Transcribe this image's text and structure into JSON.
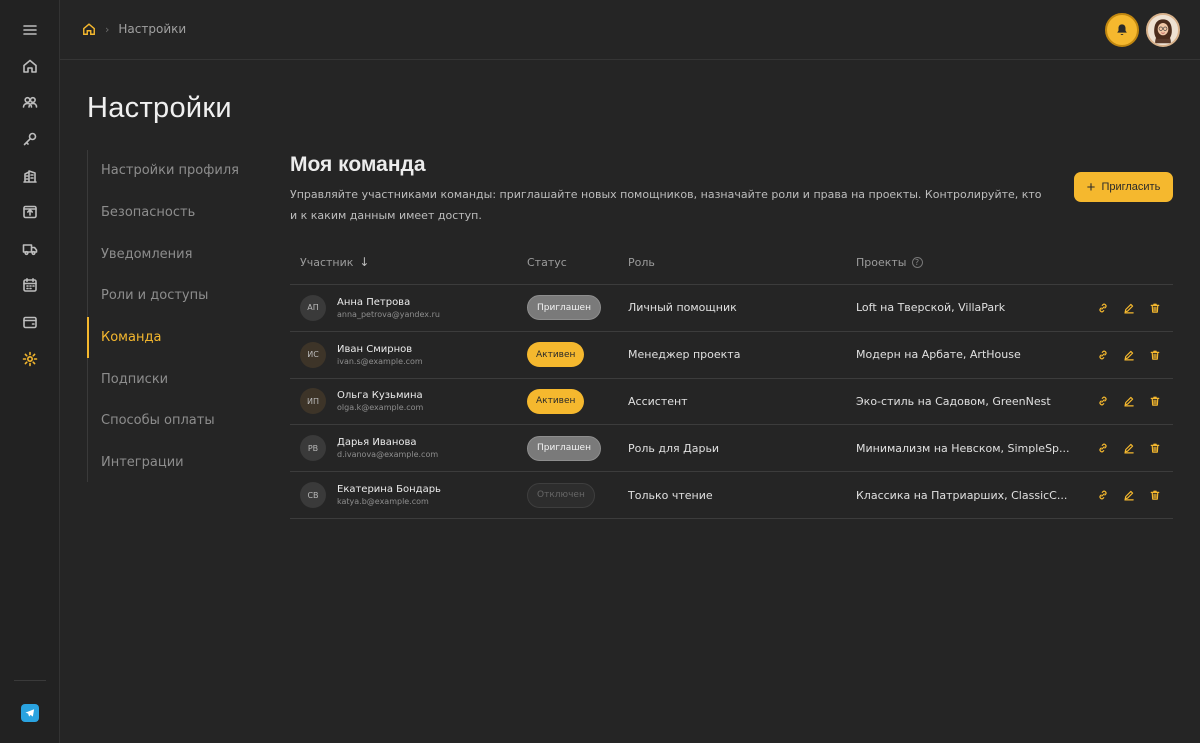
{
  "header": {
    "breadcrumb": "Настройки"
  },
  "page": {
    "title": "Настройки"
  },
  "settings_nav": [
    {
      "label": "Настройки профиля",
      "active": false
    },
    {
      "label": "Безопасность",
      "active": false
    },
    {
      "label": "Уведомления",
      "active": false
    },
    {
      "label": "Роли и доступы",
      "active": false
    },
    {
      "label": "Команда",
      "active": true
    },
    {
      "label": "Подписки",
      "active": false
    },
    {
      "label": "Способы оплаты",
      "active": false
    },
    {
      "label": "Интеграции",
      "active": false
    }
  ],
  "section": {
    "title": "Моя команда",
    "description": "Управляйте участниками команды: приглашайте новых помощников, назначайте роли и права на проекты. Контролируйте, кто и к каким данным имеет доступ.",
    "invite_label": "Пригласить"
  },
  "table": {
    "headers": {
      "member": "Участник",
      "status": "Статус",
      "role": "Роль",
      "projects": "Проекты"
    },
    "rows": [
      {
        "initials": "АП",
        "name": "Анна Петрова",
        "email": "anna_petrova@yandex.ru",
        "status": "Приглашен",
        "status_type": "invited",
        "role": "Личный помощник",
        "projects": "Loft на Тверской, VillaPark"
      },
      {
        "initials": "ИС",
        "name": "Иван Смирнов",
        "email": "ivan.s@example.com",
        "status": "Активен",
        "status_type": "active",
        "role": "Менеджер проекта",
        "projects": "Модерн на Арбате, ArtHouse"
      },
      {
        "initials": "ИП",
        "name": "Ольга Кузьмина",
        "email": "olga.k@example.com",
        "status": "Активен",
        "status_type": "active",
        "role": "Ассистент",
        "projects": "Эко-стиль на Садовом, GreenNest"
      },
      {
        "initials": "РВ",
        "name": "Дарья Иванова",
        "email": "d.ivanova@example.com",
        "status": "Приглашен",
        "status_type": "invited",
        "role": "Роль для Дарьи",
        "projects": "Минимализм на Невском, SimpleSp..."
      },
      {
        "initials": "СВ",
        "name": "Екатерина Бондарь",
        "email": "katya.b@example.com",
        "status": "Отключен",
        "status_type": "off",
        "role": "Только чтение",
        "projects": "Классика на Патриарших, ClassicC..."
      }
    ]
  },
  "colors": {
    "accent": "#f5b82e",
    "background": "#252525",
    "telegram": "#2aa3e0"
  },
  "rail_icons": [
    "menu-icon",
    "home-icon",
    "users-icon",
    "key-icon",
    "building-icon",
    "upload-box-icon",
    "truck-icon",
    "calendar-icon",
    "wallet-icon",
    "gear-icon",
    "telegram-icon"
  ]
}
